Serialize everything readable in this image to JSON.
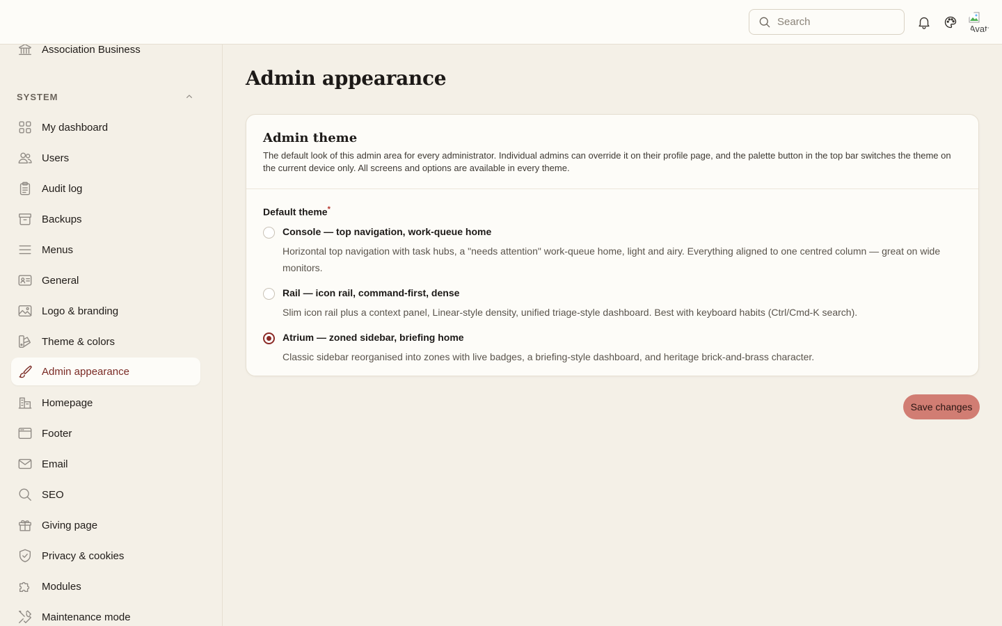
{
  "topbar": {
    "search_placeholder": "Search",
    "avatar_alt": "Avatar"
  },
  "sidebar": {
    "partial_item": {
      "label": "Association Business",
      "icon": "bank-icon"
    },
    "section_label": "SYSTEM",
    "items": [
      {
        "label": "My dashboard",
        "icon": "grid-icon"
      },
      {
        "label": "Users",
        "icon": "users-icon"
      },
      {
        "label": "Audit log",
        "icon": "clipboard-icon"
      },
      {
        "label": "Backups",
        "icon": "archive-icon"
      },
      {
        "label": "Menus",
        "icon": "menu-icon"
      },
      {
        "label": "General",
        "icon": "id-card-icon"
      },
      {
        "label": "Logo & branding",
        "icon": "image-icon"
      },
      {
        "label": "Theme & colors",
        "icon": "palette-swatch-icon"
      },
      {
        "label": "Admin appearance",
        "icon": "brush-icon"
      },
      {
        "label": "Homepage",
        "icon": "building-icon"
      },
      {
        "label": "Footer",
        "icon": "browser-window-icon"
      },
      {
        "label": "Email",
        "icon": "mail-icon"
      },
      {
        "label": "SEO",
        "icon": "magnifier-icon"
      },
      {
        "label": "Giving page",
        "icon": "gift-icon"
      },
      {
        "label": "Privacy & cookies",
        "icon": "shield-check-icon"
      },
      {
        "label": "Modules",
        "icon": "puzzle-icon"
      },
      {
        "label": "Maintenance mode",
        "icon": "tools-icon"
      }
    ],
    "active_item": "Admin appearance"
  },
  "main": {
    "title": "Admin appearance",
    "card": {
      "title": "Admin theme",
      "description": "The default look of this admin area for every administrator. Individual admins can override it on their profile page, and the palette button in the top bar switches the theme on the current device only. All screens and options are available in every theme.",
      "field_label": "Default theme",
      "required_mark": "*",
      "options": [
        {
          "title": "Console — top navigation, work-queue home",
          "description": "Horizontal top navigation with task hubs, a \"needs attention\" work-queue home, light and airy. Everything aligned to one centred column — great on wide monitors.",
          "selected": false
        },
        {
          "title": "Rail — icon rail, command-first, dense",
          "description": "Slim icon rail plus a context panel, Linear-style density, unified triage-style dashboard. Best with keyboard habits (Ctrl/Cmd-K search).",
          "selected": false
        },
        {
          "title": "Atrium — zoned sidebar, briefing home",
          "description": "Classic sidebar reorganised into zones with live badges, a briefing-style dashboard, and heritage brick-and-brass character.",
          "selected": true
        }
      ]
    },
    "save_label": "Save changes"
  },
  "colors": {
    "accent": "#8b2a25",
    "button_bg": "#d17d73",
    "page_bg": "#f4f0e7",
    "card_bg": "#fdfcf8"
  }
}
